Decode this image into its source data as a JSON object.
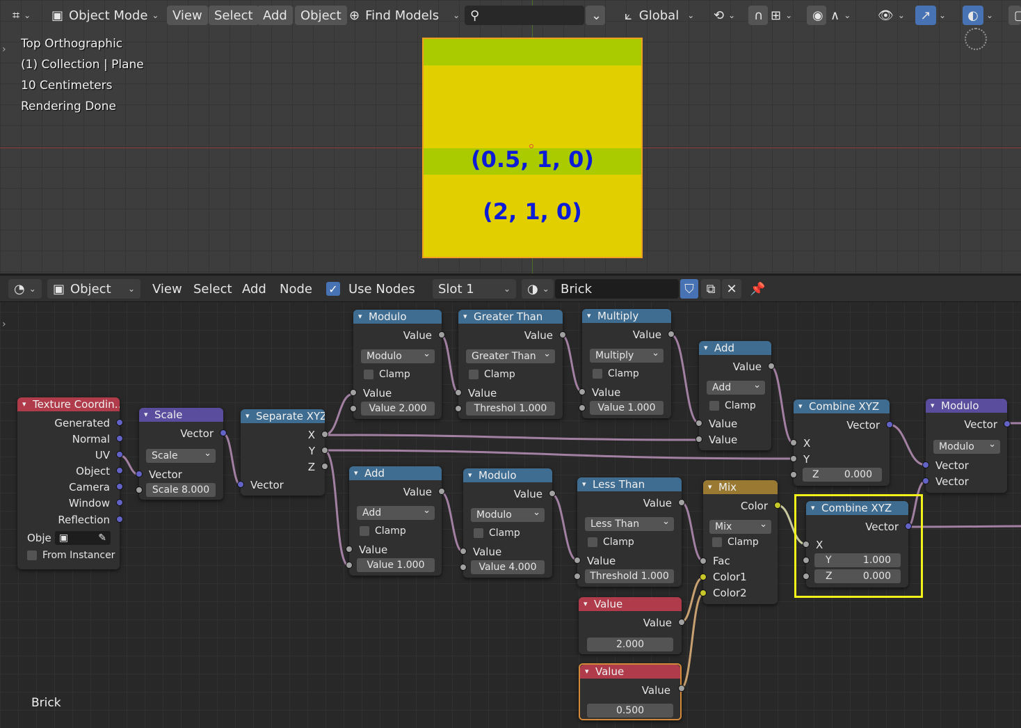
{
  "viewport": {
    "header": {
      "mode": "Object Mode",
      "menus": [
        "View",
        "Select",
        "Add",
        "Object"
      ],
      "find_models": "Find Models",
      "search_value": "",
      "transform_orientation": "Global"
    },
    "overlay": [
      "Top Orthographic",
      "(1) Collection | Plane",
      "10 Centimeters",
      "Rendering Done"
    ],
    "plane_labels": [
      "(0.5, 1, 0)",
      "(2, 1, 0)"
    ]
  },
  "node_editor": {
    "header": {
      "editor_type": "Object",
      "menus": [
        "View",
        "Select",
        "Add",
        "Node"
      ],
      "use_nodes_label": "Use Nodes",
      "slot": "Slot 1",
      "material": "Brick"
    },
    "material_label": "Brick",
    "nodes": {
      "texcoord": {
        "title": "Texture Coordin…",
        "outputs": [
          "Generated",
          "Normal",
          "UV",
          "Object",
          "Camera",
          "Window",
          "Reflection"
        ],
        "object_label": "Obje",
        "from_instancer": "From Instancer"
      },
      "scale": {
        "title": "Scale",
        "out": "Vector",
        "mode": "Scale",
        "in": "Vector",
        "field": "Scale",
        "value": "8.000"
      },
      "separate": {
        "title": "Separate XYZ",
        "outs": [
          "X",
          "Y",
          "Z"
        ],
        "in": "Vector"
      },
      "modulo1": {
        "title": "Modulo",
        "out": "Value",
        "mode": "Modulo",
        "clamp": "Clamp",
        "in": "Value",
        "field": "Value",
        "value": "2.000"
      },
      "greater": {
        "title": "Greater Than",
        "out": "Value",
        "mode": "Greater Than",
        "clamp": "Clamp",
        "in": "Value",
        "field": "Threshol",
        "value": "1.000"
      },
      "multiply": {
        "title": "Multiply",
        "out": "Value",
        "mode": "Multiply",
        "clamp": "Clamp",
        "in": "Value",
        "field": "Value",
        "value": "1.000"
      },
      "add1": {
        "title": "Add",
        "out": "Value",
        "mode": "Add",
        "clamp": "Clamp",
        "in1": "Value",
        "in2": "Value"
      },
      "combine1": {
        "title": "Combine XYZ",
        "out": "Vector",
        "x": "X",
        "y": "Y",
        "z": "Z",
        "z_value": "0.000"
      },
      "modulo_vec": {
        "title": "Modulo",
        "out": "Vector",
        "mode": "Modulo",
        "in1": "Vector",
        "in2": "Vector"
      },
      "add2": {
        "title": "Add",
        "out": "Value",
        "mode": "Add",
        "clamp": "Clamp",
        "in": "Value",
        "field": "Value",
        "value": "1.000"
      },
      "modulo2": {
        "title": "Modulo",
        "out": "Value",
        "mode": "Modulo",
        "clamp": "Clamp",
        "in": "Value",
        "field": "Value",
        "value": "4.000"
      },
      "less": {
        "title": "Less Than",
        "out": "Value",
        "mode": "Less Than",
        "clamp": "Clamp",
        "in": "Value",
        "field": "Threshold",
        "value": "1.000"
      },
      "mix": {
        "title": "Mix",
        "out": "Color",
        "mode": "Mix",
        "clamp": "Clamp",
        "fac": "Fac",
        "c1": "Color1",
        "c2": "Color2"
      },
      "combine2": {
        "title": "Combine XYZ",
        "out": "Vector",
        "x": "X",
        "y": "Y",
        "y_value": "1.000",
        "z": "Z",
        "z_value": "0.000"
      },
      "value1": {
        "title": "Value",
        "out": "Value",
        "value": "2.000"
      },
      "value2": {
        "title": "Value",
        "out": "Value",
        "value": "0.500"
      }
    }
  }
}
